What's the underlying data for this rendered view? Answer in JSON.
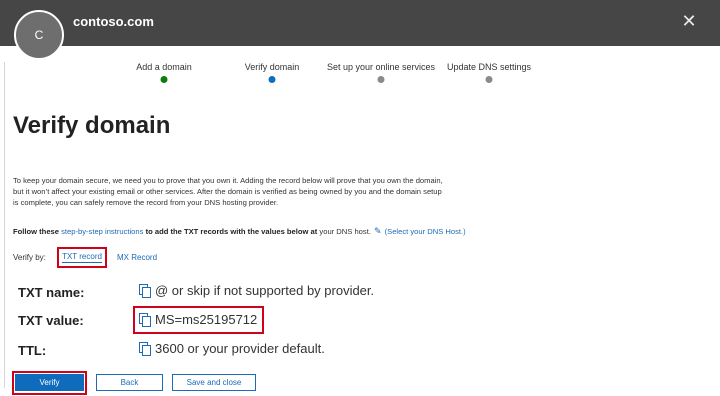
{
  "header": {
    "avatar_initial": "C",
    "domain": "contoso.com",
    "close_glyph": "✕"
  },
  "steps": [
    {
      "label": "Add a domain",
      "status": "complete",
      "color": "#107c10"
    },
    {
      "label": "Verify domain",
      "status": "current",
      "color": "#0f6cbd"
    },
    {
      "label": "Set up your online services",
      "status": "pending",
      "color": "#8a8a8a"
    },
    {
      "label": "Update DNS settings",
      "status": "pending",
      "color": "#8a8a8a"
    }
  ],
  "page": {
    "title": "Verify domain",
    "intro": "To keep your domain secure, we need you to prove that you own it. Adding the record below will prove that you own the domain, but it won’t affect your existing email or other services. After the domain is verified as being owned by you and the domain setup is complete, you can safely remove the record from your DNS hosting provider.",
    "follow_pre": "Follow these",
    "follow_link": "step-by-step instructions",
    "follow_mid": "to add the TXT records with the values below at",
    "follow_post": "your DNS host.",
    "select_host_link": "(Select your DNS Host.)",
    "pencil_icon": "pencil-icon"
  },
  "verify_by": {
    "label": "Verify by:",
    "tabs": [
      "TXT record",
      "MX Record"
    ],
    "selected": "TXT record"
  },
  "records": [
    {
      "label": "TXT name:",
      "value": "@ or skip if not supported by provider."
    },
    {
      "label": "TXT value:",
      "value": "MS=ms25195712"
    },
    {
      "label": "TTL:",
      "value": "3600 or your provider default."
    }
  ],
  "buttons": {
    "verify": "Verify",
    "back": "Back",
    "save_close": "Save and close"
  },
  "colors": {
    "header_bg": "#464646",
    "accent": "#0f6cbd",
    "link": "#1e6ab4",
    "highlight": "#d0021b"
  }
}
